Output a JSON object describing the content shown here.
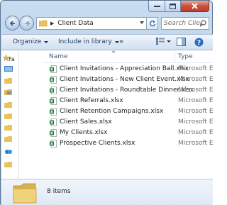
{
  "window": {
    "address_path": "Client Data",
    "search_placeholder": "Search Clien..."
  },
  "toolbar": {
    "organize_label": "Organize",
    "library_label": "Include in library",
    "more_label": "»"
  },
  "navigation": {
    "favorites_label": "Fa"
  },
  "columns": {
    "name": "Name",
    "type": "Type"
  },
  "files": [
    {
      "name": "Client Invitations - Appreciation Ball.xlsx",
      "type": "Microsoft Ex",
      "icon": "excel-icon"
    },
    {
      "name": "Client Invitations - New Client Event.xlsx",
      "type": "Microsoft Ex",
      "icon": "excel-icon"
    },
    {
      "name": "Client Invitations - Roundtable Dinner.xlsx",
      "type": "Microsoft Ex",
      "icon": "excel-icon"
    },
    {
      "name": "Client Referrals.xlsx",
      "type": "Microsoft Ex",
      "icon": "excel-icon"
    },
    {
      "name": "Client Retention Campaigns.xlsx",
      "type": "Microsoft Ex",
      "icon": "excel-icon"
    },
    {
      "name": "Client Sales.xlsx",
      "type": "Microsoft Ex",
      "icon": "excel-icon"
    },
    {
      "name": "My Clients.xlsx",
      "type": "Microsoft Ex",
      "icon": "excel-icon"
    },
    {
      "name": "Prospective Clients.xlsx",
      "type": "Microsoft Ex",
      "icon": "excel-icon"
    }
  ],
  "details": {
    "item_count": "8 items"
  },
  "colors": {
    "excel_green": "#1f7a3e",
    "folder_yellow": "#e8c55a",
    "close_red": "#c7513b"
  }
}
